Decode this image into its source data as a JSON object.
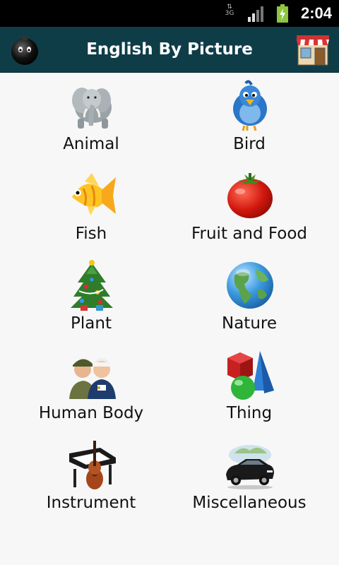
{
  "status_bar": {
    "network": "3G",
    "time": "2:04",
    "icons": [
      "data-arrows-icon",
      "signal-icon",
      "battery-charging-icon"
    ]
  },
  "title_bar": {
    "title": "English By Picture",
    "left_icon": "bomb-icon",
    "right_icon": "store-icon",
    "background": "#0e3d48"
  },
  "categories": [
    {
      "label": "Animal",
      "icon": "elephant-icon"
    },
    {
      "label": "Bird",
      "icon": "bird-icon"
    },
    {
      "label": "Fish",
      "icon": "fish-icon"
    },
    {
      "label": "Fruit and Food",
      "icon": "tomato-icon"
    },
    {
      "label": "Plant",
      "icon": "christmas-tree-icon"
    },
    {
      "label": "Nature",
      "icon": "globe-icon"
    },
    {
      "label": "Human Body",
      "icon": "people-icon"
    },
    {
      "label": "Thing",
      "icon": "shapes-icon"
    },
    {
      "label": "Instrument",
      "icon": "instruments-icon"
    },
    {
      "label": "Miscellaneous",
      "icon": "car-icon"
    }
  ]
}
